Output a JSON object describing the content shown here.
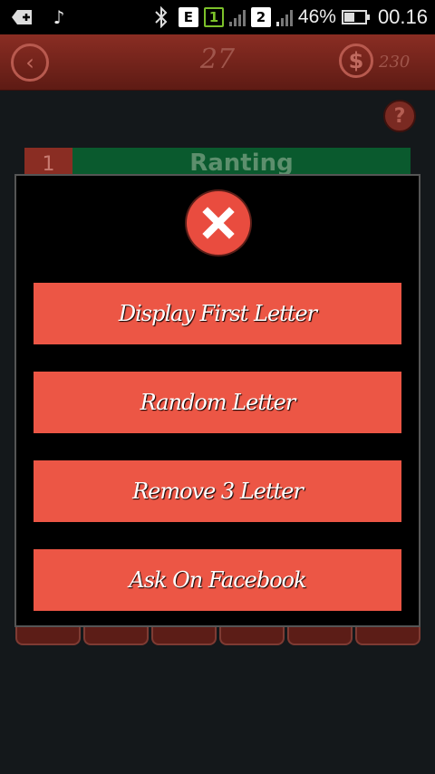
{
  "status_bar": {
    "battery_percent": "46%",
    "battery_level": 0.46,
    "time": "00.16",
    "sim1_label": "1",
    "sim2_label": "2",
    "network_label": "E",
    "icons": [
      "notification-plus-icon",
      "music-note-icon",
      "bluetooth-icon",
      "signal-icon",
      "battery-icon"
    ]
  },
  "topbar": {
    "level": "27",
    "coins": "230",
    "coin_symbol": "$",
    "back_symbol": "‹"
  },
  "help": {
    "symbol": "?"
  },
  "word_row": {
    "number": "1",
    "text": "Ranting"
  },
  "dialog": {
    "options": [
      {
        "label": "Display First Letter"
      },
      {
        "label": "Random Letter"
      },
      {
        "label": "Remove 3 Letter"
      },
      {
        "label": "Ask On Facebook"
      }
    ]
  },
  "colors": {
    "accent": "#ec5645",
    "topbar": "#7a2a22",
    "word_row_bg": "#0a5a2e",
    "background": "#14181b"
  }
}
